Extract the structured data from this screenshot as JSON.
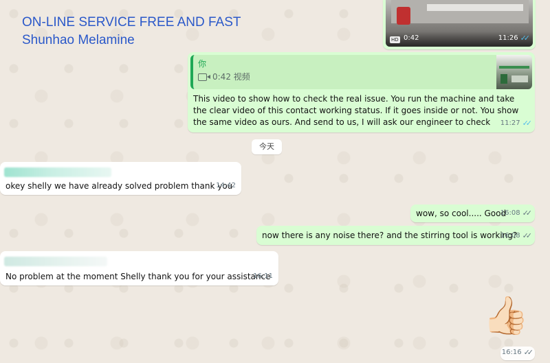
{
  "promo": {
    "line1": "ON-LINE SERVICE FREE AND FAST",
    "line2": "Shunhao Melamine"
  },
  "video_card": {
    "duration": "0:42",
    "time": "11:26",
    "hd_label": "HD"
  },
  "reply_message": {
    "quote_author": "你",
    "quote_text": "0:42 视频",
    "text": "This video to show how to check the real issue. You run the machine and take the clear video of this contact working status. If it goes inside or not. You show the same video as ours. And send to us, I will ask our engineer to check",
    "time": "11:27"
  },
  "date_chip": "今天",
  "messages": {
    "m1": {
      "text": "okey shelly we have already solved problem thank you",
      "time": "14:42"
    },
    "m2": {
      "text": "wow, so cool..... Good",
      "time": "16:08"
    },
    "m3": {
      "text": "now there is any noise there? and the stirring tool is working?",
      "time": "16:08"
    },
    "m4": {
      "text": "No problem at the moment Shelly thank you for your assistance",
      "time": "16:11"
    },
    "m5": {
      "emoji": "👍🏻",
      "time": "16:16"
    }
  },
  "colors": {
    "outgoing": "#d9fdd3",
    "incoming": "#ffffff",
    "promo_text": "#2a58c9",
    "read_ticks": "#53bdeb"
  }
}
